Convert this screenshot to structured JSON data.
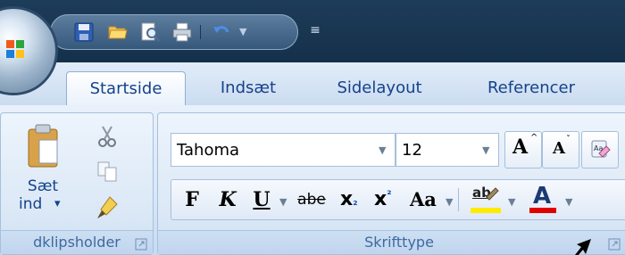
{
  "tabs": [
    "Startside",
    "Indsæt",
    "Sidelayout",
    "Referencer"
  ],
  "clipboard": {
    "paste_label_1": "Sæt",
    "paste_label_2": "ind",
    "paste_arrow": "▾",
    "group_label": "dklipsholder"
  },
  "font": {
    "font_name": "Tahoma",
    "font_size": "12",
    "group_label": "Skrifttype",
    "bold": "F",
    "italic": "K",
    "underline": "U",
    "strike": "abe",
    "subscript": "x",
    "subscript_mark": "₂",
    "superscript": "x",
    "superscript_mark": "²",
    "change_case": "Aa",
    "grow_font": "A",
    "shrink_font": "A",
    "highlight_text": "ab",
    "font_color_text": "A"
  },
  "colors": {
    "highlight": "#ffeb00",
    "font_color": "#e00000"
  },
  "icons": {
    "save": "save-icon",
    "open": "open-folder-icon",
    "print_preview": "print-preview-icon",
    "print": "printer-icon",
    "undo": "undo-icon",
    "customize": "customize-qat-icon",
    "cut": "scissors-icon",
    "copy": "copy-icon",
    "format_painter": "format-painter-icon",
    "paste": "paste-icon",
    "clear_formatting": "clear-formatting-icon"
  }
}
